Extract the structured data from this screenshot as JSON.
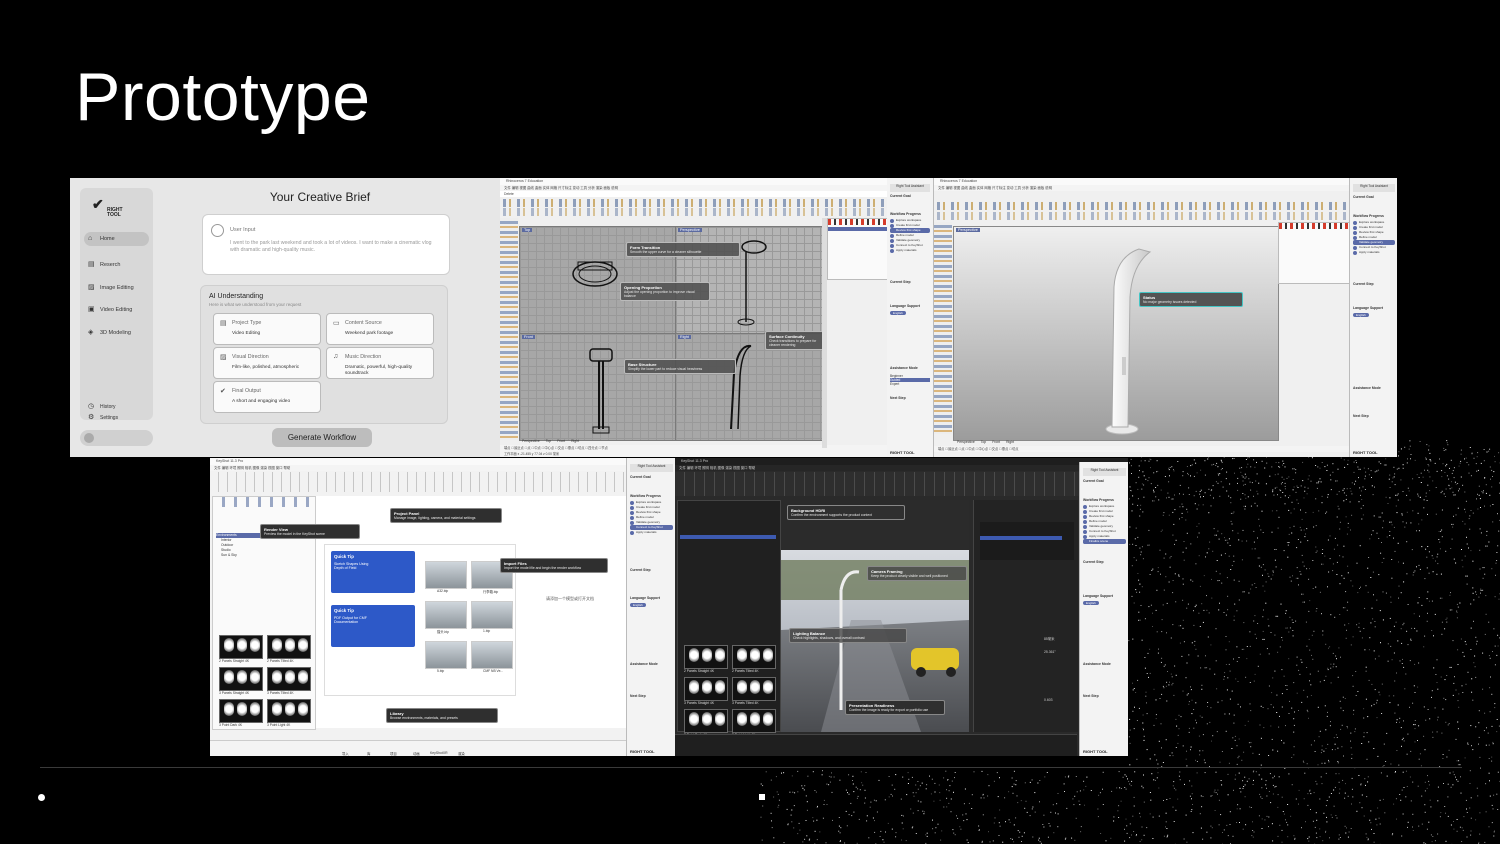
{
  "slide": {
    "title": "Prototype"
  },
  "brief_app": {
    "logo_text": "RIGHT TOOL",
    "nav": [
      {
        "label": "Home",
        "icon": "home-icon",
        "active": true
      },
      {
        "label": "Reserch",
        "icon": "search-icon"
      },
      {
        "label": "Image Editing",
        "icon": "image-icon"
      },
      {
        "label": "Video Editing",
        "icon": "video-icon"
      },
      {
        "label": "3D Modeling",
        "icon": "cube-icon"
      }
    ],
    "footer_nav": [
      {
        "label": "History",
        "icon": "clock-icon"
      },
      {
        "label": "Settings",
        "icon": "gear-icon"
      }
    ],
    "heading": "Your Creative Brief",
    "user_input": {
      "label": "User Input",
      "value": "I went to the park last weekend and took a lot of videos. I want to make a cinematic vlog with dramatic and high-quality music."
    },
    "ai": {
      "title": "AI Understanding",
      "subtitle": "Here is what we understood from your request",
      "tiles": [
        {
          "key": "Project Type",
          "value": "Video Editing",
          "icon": "document-icon"
        },
        {
          "key": "Content Source",
          "value": "Weekend park footage",
          "icon": "folder-icon"
        },
        {
          "key": "Visual Direction",
          "value": "Film-like, polished, atmospheric",
          "icon": "image-icon"
        },
        {
          "key": "Music Direction",
          "value": "Dramatic, powerful, high-quality soundtrack",
          "icon": "music-icon"
        },
        {
          "key": "Final Output",
          "value": "A short and engaging video",
          "icon": "check-circle-icon"
        }
      ]
    },
    "generate_label": "Generate Workflow"
  },
  "rhino1": {
    "window_title": "Rhinoceros 7 Education",
    "command_label": "Delete",
    "viewports": [
      "Top",
      "Perspective",
      "Front",
      "Right"
    ],
    "view_tabs": [
      "Perspective",
      "Top",
      "Front",
      "Right"
    ],
    "callouts": [
      {
        "title": "Form Transition",
        "body": "Smooth the upper curve for a cleaner silhouette"
      },
      {
        "title": "Opening Proportion",
        "body": "Adjust the opening proportion to improve visual balance"
      },
      {
        "title": "Surface Continuity",
        "body": "Check transitions to prepare for cleaner rendering"
      },
      {
        "title": "Base Structure",
        "body": "Simplify the lower part to reduce visual heaviness"
      }
    ]
  },
  "rhino2": {
    "window_title": "Rhinoceros 7 Education",
    "viewport_label": "Perspective",
    "view_tabs": [
      "Perspective",
      "Top",
      "Front",
      "Right"
    ],
    "status_callout": {
      "title": "Status",
      "body": "No major geometry issues detected"
    }
  },
  "assistant": {
    "header": "Right Tool Assistant",
    "current_goal": "Current Goal",
    "workflow_title": "Workflow Progress",
    "steps": [
      "Explore workspace",
      "Create first model",
      "Review first shape",
      "Refine model",
      "Validate geometry",
      "Connect to KeyShot",
      "Apply materials",
      "Finalize scene"
    ],
    "current_step": "Current Step",
    "language": "Language Support",
    "language_value": "English",
    "assistance_mode": "Assistance Mode",
    "mode_options": [
      "Beginner",
      "Guided",
      "Expert"
    ],
    "next_step": "Next Step",
    "logo": "RIGHT TOOL"
  },
  "keyshot_light": {
    "window_title": "KeyShot 11.3 Pro",
    "callouts": [
      {
        "title": "Render View",
        "body": "Preview the model in the KeyShot scene"
      },
      {
        "title": "Project Panel",
        "body": "Manage image, lighting, camera, and material settings"
      },
      {
        "title": "Import Files",
        "body": "Import the model file and begin the render workflow"
      },
      {
        "title": "Library",
        "body": "Browse environments, materials, and presets"
      }
    ],
    "tree": [
      "Environments",
      "Interior",
      "Outdoor",
      "Studio",
      "Sun & Sky"
    ],
    "thumbs": [
      "2 Panels Straight 4K",
      "2 Panels Tilted 4K",
      "3 Panels Straight 4K",
      "3 Panels Tilted 4K",
      "3 Point Dark 4K",
      "3 Point Light 4K"
    ],
    "quicktips": [
      {
        "title": "Quick Tip",
        "body": "Sketch Shapes Using Depth of Field"
      },
      {
        "title": "Quick Tip",
        "body": "PDF Output for CMF Documentation"
      }
    ],
    "files": [
      "A32.bip",
      "行李箱.bip",
      "猫头.bip",
      "1.bip",
      "5.bip",
      "CMF NB Ve..."
    ],
    "empty_hint": "请添加一个模型或打开文档",
    "bottom_tabs": [
      "导入",
      "库",
      "项目",
      "动画",
      "KeyShotXR",
      "渲染"
    ]
  },
  "keyshot_dark": {
    "window_title": "KeyShot 11.3 Pro",
    "callouts": [
      {
        "title": "Background HDRI",
        "body": "Confirm the environment supports the product context"
      },
      {
        "title": "Camera Framing",
        "body": "Keep the product clearly visible and well positioned"
      },
      {
        "title": "Lighting Balance",
        "body": "Check highlights, shadows, and overall contrast"
      },
      {
        "title": "Presentation Readiness",
        "body": "Confirm the image is ready for export or portfolio use"
      }
    ],
    "thumbs": [
      "2 Panels Straight 4K",
      "2 Panels Tilted 4K",
      "3 Panels Straight 4K",
      "3 Panels Tilted 4K",
      "3 Point Dark 4K",
      "3 Point Light 4K"
    ],
    "right_panel_values": [
      "85毫米",
      "25.361°",
      "0.603"
    ]
  },
  "colors": {
    "slide_bg": "#000000",
    "accent_blue": "#5a6aa8",
    "callout_teal": "#45c6c6",
    "car_yellow": "#e3c52a"
  }
}
